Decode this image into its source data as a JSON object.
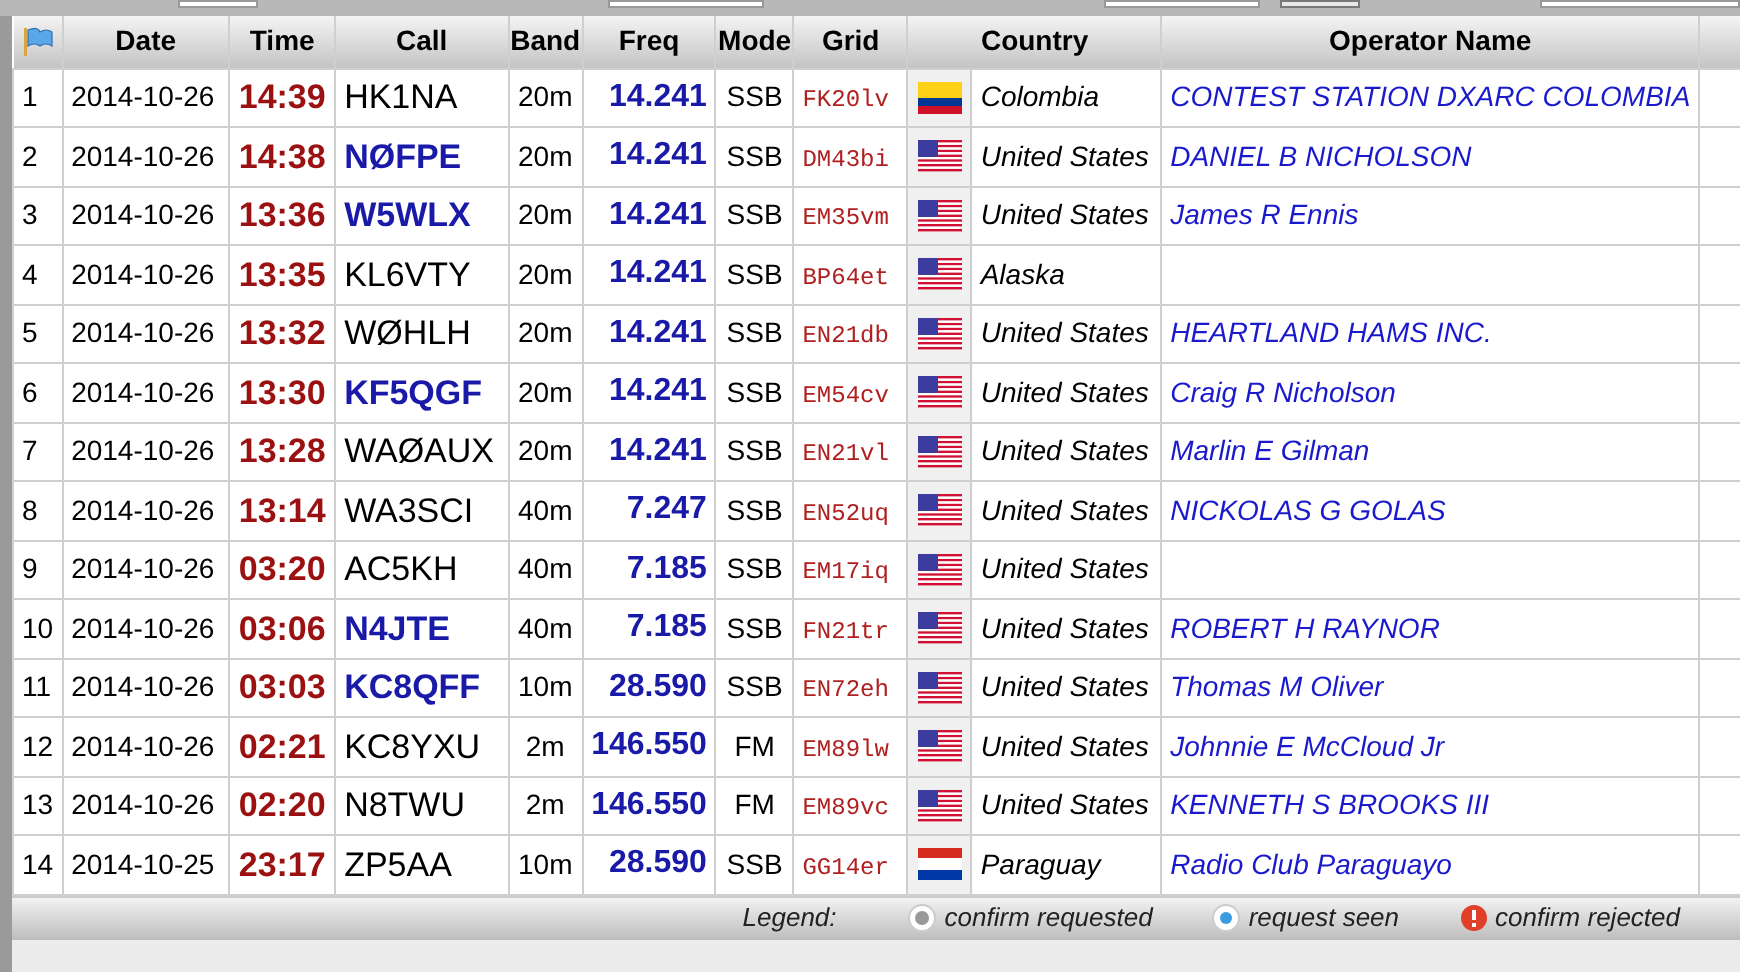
{
  "columns": [
    "Date",
    "Time",
    "Call",
    "Band",
    "Freq",
    "Mode",
    "Grid",
    "Country",
    "Operator Name"
  ],
  "rows": [
    {
      "num": "1",
      "date": "2014-10-26",
      "time": "14:39",
      "call": "HK1NA",
      "linked": false,
      "band": "20m",
      "freq": "14.241",
      "mode": "SSB",
      "grid": "FK20lv",
      "kind": "co",
      "country": "Colombia",
      "operator": "CONTEST STATION DXARC COLOMBIA"
    },
    {
      "num": "2",
      "date": "2014-10-26",
      "time": "14:38",
      "call": "NØFPE",
      "linked": true,
      "band": "20m",
      "freq": "14.241",
      "mode": "SSB",
      "grid": "DM43bi",
      "kind": "us",
      "country": "United States",
      "operator": "DANIEL B NICHOLSON"
    },
    {
      "num": "3",
      "date": "2014-10-26",
      "time": "13:36",
      "call": "W5WLX",
      "linked": true,
      "band": "20m",
      "freq": "14.241",
      "mode": "SSB",
      "grid": "EM35vm",
      "kind": "us",
      "country": "United States",
      "operator": "James R Ennis"
    },
    {
      "num": "4",
      "date": "2014-10-26",
      "time": "13:35",
      "call": "KL6VTY",
      "linked": false,
      "band": "20m",
      "freq": "14.241",
      "mode": "SSB",
      "grid": "BP64et",
      "kind": "us",
      "country": "Alaska"
    },
    {
      "num": "5",
      "date": "2014-10-26",
      "time": "13:32",
      "call": "WØHLH",
      "linked": false,
      "band": "20m",
      "freq": "14.241",
      "mode": "SSB",
      "grid": "EN21db",
      "kind": "us",
      "country": "United States",
      "operator": "HEARTLAND HAMS INC."
    },
    {
      "num": "6",
      "date": "2014-10-26",
      "time": "13:30",
      "call": "KF5QGF",
      "linked": true,
      "band": "20m",
      "freq": "14.241",
      "mode": "SSB",
      "grid": "EM54cv",
      "kind": "us",
      "country": "United States",
      "operator": "Craig R Nicholson"
    },
    {
      "num": "7",
      "date": "2014-10-26",
      "time": "13:28",
      "call": "WAØAUX",
      "linked": false,
      "band": "20m",
      "freq": "14.241",
      "mode": "SSB",
      "grid": "EN21vl",
      "kind": "us",
      "country": "United States",
      "operator": "Marlin E Gilman"
    },
    {
      "num": "8",
      "date": "2014-10-26",
      "time": "13:14",
      "call": "WA3SCI",
      "linked": false,
      "band": "40m",
      "freq": "7.247",
      "mode": "SSB",
      "grid": "EN52uq",
      "kind": "us",
      "country": "United States",
      "operator": "NICKOLAS G GOLAS"
    },
    {
      "num": "9",
      "date": "2014-10-26",
      "time": "03:20",
      "call": "AC5KH",
      "linked": false,
      "band": "40m",
      "freq": "7.185",
      "mode": "SSB",
      "grid": "EM17iq",
      "kind": "us",
      "country": "United States"
    },
    {
      "num": "10",
      "date": "2014-10-26",
      "time": "03:06",
      "call": "N4JTE",
      "linked": true,
      "band": "40m",
      "freq": "7.185",
      "mode": "SSB",
      "grid": "FN21tr",
      "kind": "us",
      "country": "United States",
      "operator": "ROBERT H RAYNOR"
    },
    {
      "num": "11",
      "date": "2014-10-26",
      "time": "03:03",
      "call": "KC8QFF",
      "linked": true,
      "band": "10m",
      "freq": "28.590",
      "mode": "SSB",
      "grid": "EN72eh",
      "kind": "us",
      "country": "United States",
      "operator": "Thomas M Oliver"
    },
    {
      "num": "12",
      "date": "2014-10-26",
      "time": "02:21",
      "call": "KC8YXU",
      "linked": false,
      "band": "2m",
      "freq": "146.550",
      "mode": "FM",
      "grid": "EM89lw",
      "kind": "us",
      "country": "United States",
      "operator": "Johnnie E McCloud Jr"
    },
    {
      "num": "13",
      "date": "2014-10-26",
      "time": "02:20",
      "call": "N8TWU",
      "linked": false,
      "band": "2m",
      "freq": "146.550",
      "mode": "FM",
      "grid": "EM89vc",
      "kind": "us",
      "country": "United States",
      "operator": "KENNETH S BROOKS III"
    },
    {
      "num": "14",
      "date": "2014-10-25",
      "time": "23:17",
      "call": "ZP5AA",
      "linked": false,
      "band": "10m",
      "freq": "28.590",
      "mode": "SSB",
      "grid": "GG14er",
      "kind": "py",
      "country": "Paraguay",
      "operator": "Radio Club Paraguayo"
    }
  ],
  "legend": {
    "title": "Legend:",
    "items": [
      {
        "kind": "requested",
        "label": "confirm requested"
      },
      {
        "kind": "seen",
        "label": "request seen"
      },
      {
        "kind": "rejected",
        "label": "confirm rejected"
      }
    ]
  }
}
